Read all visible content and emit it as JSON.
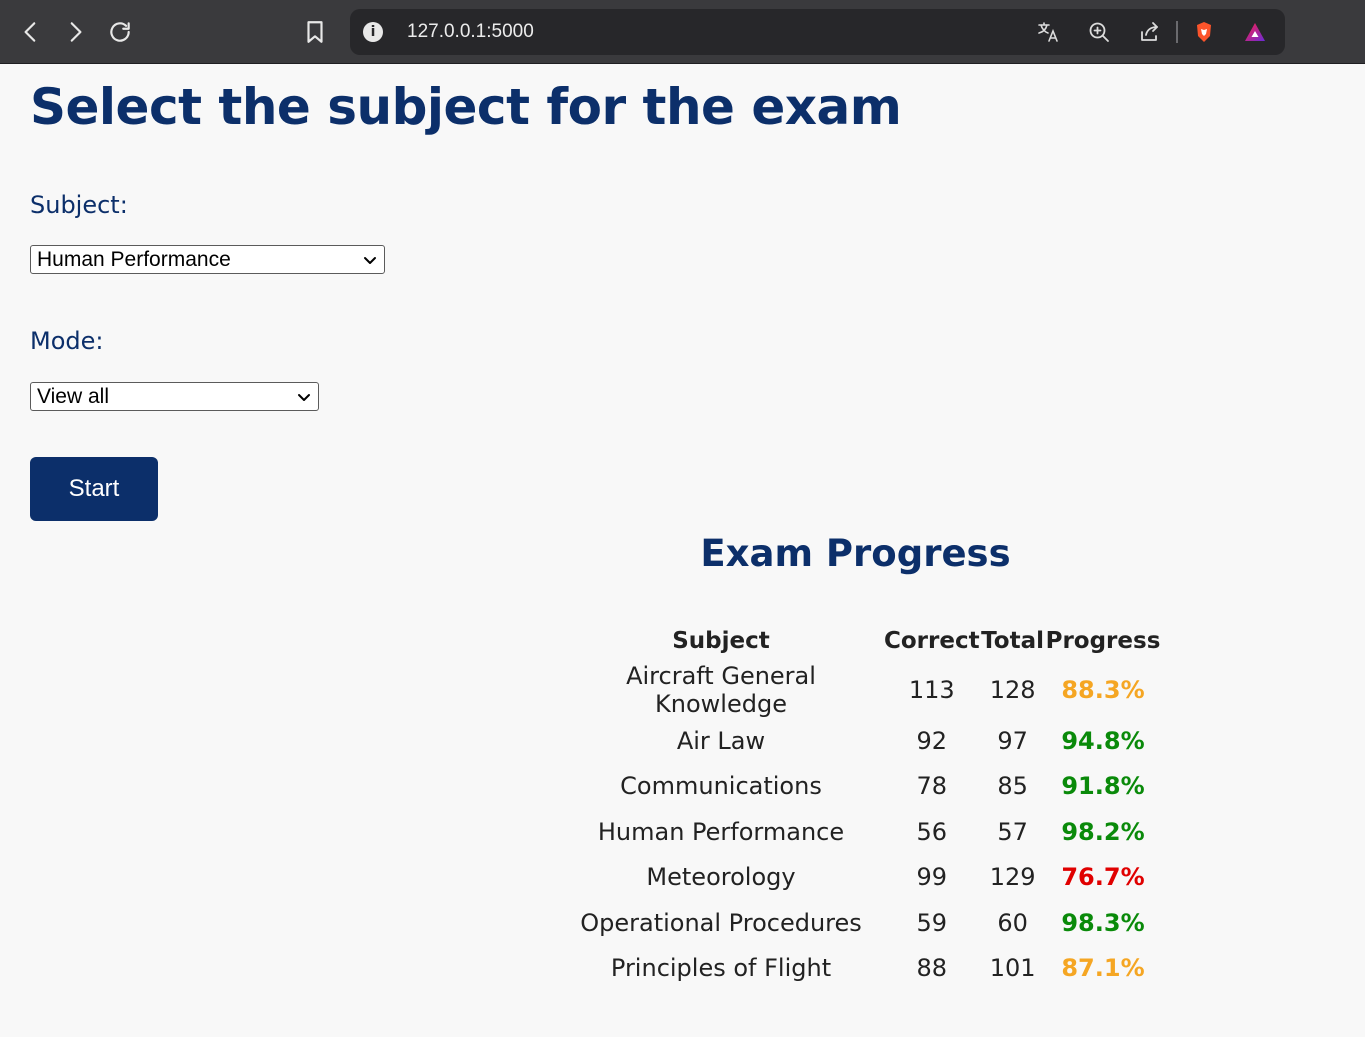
{
  "browser": {
    "url": "127.0.0.1:5000",
    "icons": [
      "back-icon",
      "forward-icon",
      "reload-icon",
      "bookmark-icon",
      "info-icon",
      "translate-icon",
      "zoom-icon",
      "share-icon",
      "brave-shield-icon",
      "brave-rewards-icon"
    ]
  },
  "page": {
    "title": "Select the subject for the exam",
    "subject_label": "Subject:",
    "subject_value": "Human Performance",
    "mode_label": "Mode:",
    "mode_value": "View all",
    "start_label": "Start"
  },
  "progress": {
    "title": "Exam Progress",
    "headers": [
      "Subject",
      "Correct",
      "Total",
      "Progress"
    ],
    "rows": [
      {
        "subject": "Aircraft General Knowledge",
        "correct": "113",
        "total": "128",
        "progress": "88.3%",
        "color": "#f5a623"
      },
      {
        "subject": "Air Law",
        "correct": "92",
        "total": "97",
        "progress": "94.8%",
        "color": "#0a8a0a"
      },
      {
        "subject": "Communications",
        "correct": "78",
        "total": "85",
        "progress": "91.8%",
        "color": "#0a8a0a"
      },
      {
        "subject": "Human Performance",
        "correct": "56",
        "total": "57",
        "progress": "98.2%",
        "color": "#0a8a0a"
      },
      {
        "subject": "Meteorology",
        "correct": "99",
        "total": "129",
        "progress": "76.7%",
        "color": "#e00000"
      },
      {
        "subject": "Operational Procedures",
        "correct": "59",
        "total": "60",
        "progress": "98.3%",
        "color": "#0a8a0a"
      },
      {
        "subject": "Principles of Flight",
        "correct": "88",
        "total": "101",
        "progress": "87.1%",
        "color": "#f5a623"
      }
    ]
  },
  "colors": {
    "brand": "#0c2f6a",
    "background": "#f8f8f8"
  }
}
